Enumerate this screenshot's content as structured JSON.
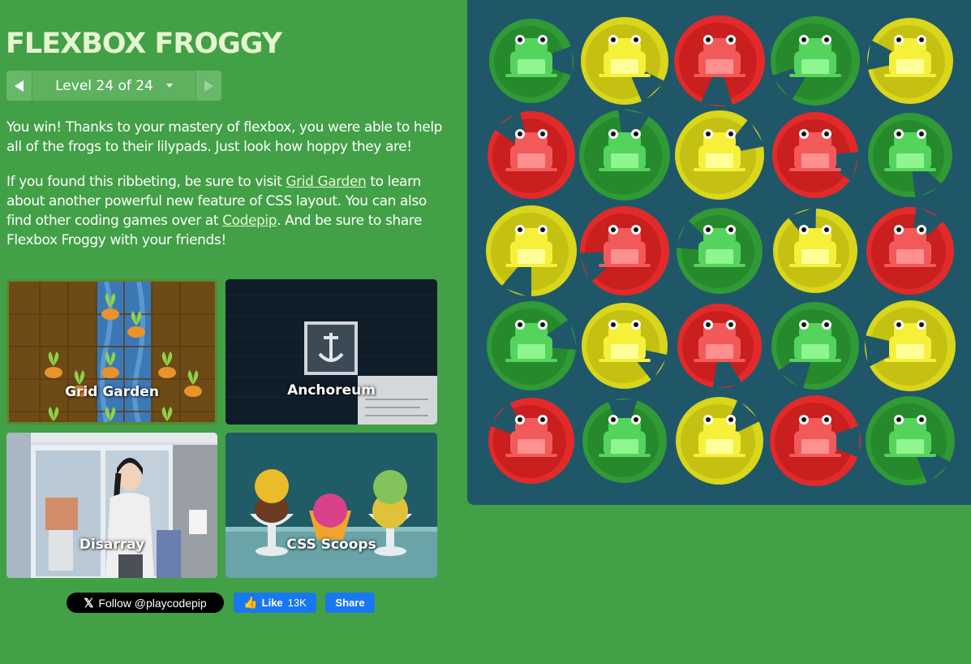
{
  "header": {
    "title": "FLEXBOX FROGGY"
  },
  "level_nav": {
    "label": "Level 24 of 24"
  },
  "win_message": "You win! Thanks to your mastery of flexbox, you were able to help all of the frogs to their lilypads. Just look how hoppy they are!",
  "promo": {
    "part1": "If you found this ribbeting, be sure to visit ",
    "link1": "Grid Garden",
    "part2": " to learn about another powerful new feature of CSS layout. You can also find other coding games over at ",
    "link2": "Codepip",
    "part3": ". And be sure to share Flexbox Froggy with your friends!"
  },
  "games": [
    {
      "name": "Grid Garden"
    },
    {
      "name": "Anchoreum"
    },
    {
      "name": "Disarray"
    },
    {
      "name": "CSS Scoops"
    }
  ],
  "social": {
    "x_follow": "Follow @playcodepip",
    "fb_like": "Like",
    "fb_like_count": "13K",
    "fb_share": "Share"
  },
  "colors": {
    "background": "#42a046",
    "pond": "#1f5768",
    "red": "#e32a2a",
    "green": "#2f9a36",
    "yellow": "#d9d61b"
  },
  "pond": {
    "rows": [
      [
        "green",
        "yellow",
        "red",
        "green",
        "yellow"
      ],
      [
        "red",
        "green",
        "yellow",
        "red",
        "green"
      ],
      [
        "yellow",
        "red",
        "green",
        "yellow",
        "red"
      ],
      [
        "green",
        "yellow",
        "red",
        "green",
        "yellow"
      ],
      [
        "red",
        "green",
        "yellow",
        "red",
        "green"
      ]
    ]
  }
}
